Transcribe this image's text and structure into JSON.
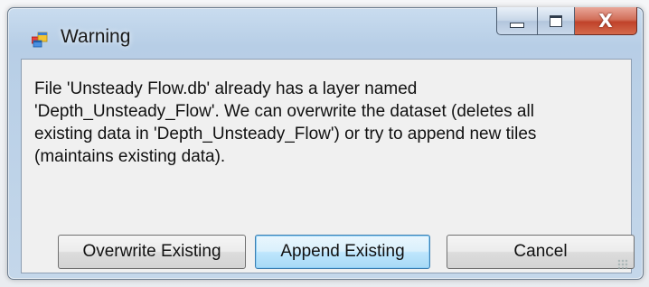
{
  "window": {
    "title": "Warning",
    "icon": "app-window-icon",
    "caption_buttons": {
      "minimize_icon": "minimize-icon",
      "maximize_icon": "maximize-icon",
      "close_icon": "close-icon",
      "close_glyph": "X"
    }
  },
  "dialog": {
    "message_lines": [
      "File 'Unsteady Flow.db' already has a layer named",
      "'Depth_Unsteady_Flow'. We can overwrite the dataset (deletes all",
      "existing data in 'Depth_Unsteady_Flow') or try to append new tiles",
      "(maintains existing data)."
    ],
    "buttons": {
      "overwrite_label": "Overwrite Existing",
      "append_label": "Append Existing",
      "cancel_label": "Cancel"
    }
  },
  "colors": {
    "accent_button_border": "#3c7fb1",
    "close_button": "#c0422a"
  }
}
